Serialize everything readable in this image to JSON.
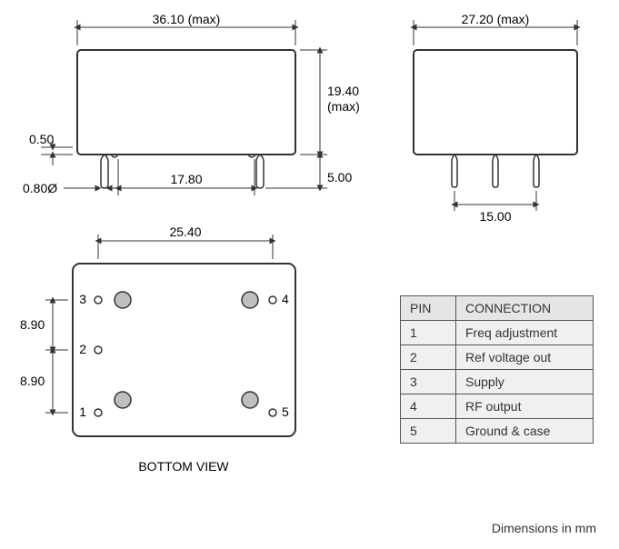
{
  "dimensions": {
    "front_width": "36.10 (max)",
    "side_width": "27.20 (max)",
    "height": "19.40\n(max)",
    "pin_length": "5.00",
    "pin_spacing_front": "17.80",
    "pin_spacing_side": "15.00",
    "pin_diameter": "0.80Ø",
    "pin_stub": "0.50",
    "bottom_span": "25.40",
    "bottom_row_spacing_a": "8.90",
    "bottom_row_spacing_b": "8.90"
  },
  "pins": {
    "p1": "1",
    "p2": "2",
    "p3": "3",
    "p4": "4",
    "p5": "5"
  },
  "table": {
    "header_pin": "PIN",
    "header_conn": "CONNECTION",
    "rows": [
      {
        "pin": "1",
        "conn": "Freq adjustment"
      },
      {
        "pin": "2",
        "conn": "Ref voltage out"
      },
      {
        "pin": "3",
        "conn": "Supply"
      },
      {
        "pin": "4",
        "conn": "RF output"
      },
      {
        "pin": "5",
        "conn": "Ground & case"
      }
    ]
  },
  "labels": {
    "bottom_view": "BOTTOM VIEW",
    "units": "Dimensions in mm"
  }
}
